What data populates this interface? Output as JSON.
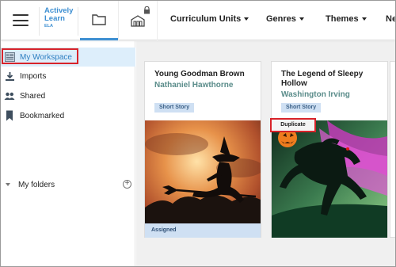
{
  "app": {
    "logo_line1": "Actively",
    "logo_line2": "Learn",
    "logo_line3": "ELA"
  },
  "topbar": {
    "menu": [
      {
        "label": "Curriculum Units"
      },
      {
        "label": "Genres"
      },
      {
        "label": "Themes"
      },
      {
        "label": "Ne"
      }
    ]
  },
  "sidebar": {
    "items": [
      {
        "label": "My Workspace",
        "icon": "workspace-icon",
        "active": true
      },
      {
        "label": "Imports",
        "icon": "download-icon"
      },
      {
        "label": "Shared",
        "icon": "people-icon"
      },
      {
        "label": "Bookmarked",
        "icon": "bookmark-icon"
      }
    ],
    "folders_label": "My folders",
    "add_symbol": "+"
  },
  "cards": [
    {
      "title": "Young Goodman Brown",
      "author": "Nathaniel Hawthorne",
      "badge": "Short Story",
      "footer": "Assigned"
    },
    {
      "title": "The Legend of Sleepy Hollow",
      "author": "Washington Irving",
      "badge": "Short Story",
      "duplicate_label": "Duplicate"
    }
  ],
  "colors": {
    "accent": "#3d8fd2",
    "highlight": "#d8232a",
    "author": "#5a8c8a",
    "badge_bg": "#cfe0f3"
  }
}
